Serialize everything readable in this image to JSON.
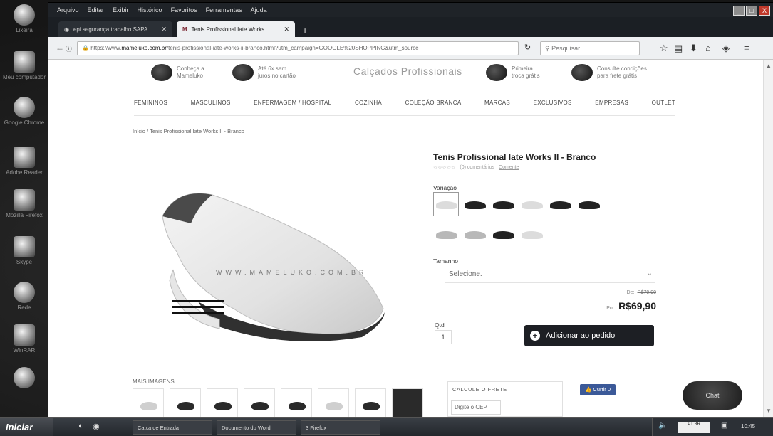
{
  "browser": {
    "menu": [
      "Arquivo",
      "Editar",
      "Exibir",
      "Histórico",
      "Favoritos",
      "Ferramentas",
      "Ajuda"
    ],
    "tabs": [
      {
        "label": "epi segurança trabalho SAPA",
        "active": false
      },
      {
        "label": "Tenis Profissional Iate Works ...",
        "active": true
      }
    ],
    "new_tab": "+",
    "url_prefix": "https://www.",
    "url_domain": "mameluko.com.br",
    "url_rest": "/tenis-profissional-iate-works-ii-branco.html?utm_campaign=GOOGLE%20SHOPPING&utm_source",
    "search_placeholder": "Pesquisar",
    "win_controls": [
      "_",
      "□",
      "X"
    ]
  },
  "header": {
    "benefits": [
      {
        "line1": "Conheça a",
        "line2": "Mameluko"
      },
      {
        "line1": "Até 6x sem",
        "line2": "juros no cartão"
      },
      {
        "line1": "Primeira",
        "line2": "troca grátis"
      },
      {
        "line1": "Consulte condições",
        "line2": "para frete grátis"
      }
    ],
    "logo": "Calçados Profissionais"
  },
  "categories": [
    "FEMININOS",
    "MASCULINOS",
    "ENFERMAGEM / HOSPITAL",
    "COZINHA",
    "COLEÇÃO BRANCA",
    "MARCAS",
    "EXCLUSIVOS",
    "EMPRESAS",
    "OUTLET"
  ],
  "breadcrumb": {
    "home": "Início",
    "separator": " / ",
    "current": "Tenis Profissional Iate Works II - Branco"
  },
  "gallery": {
    "watermark": "WWW.MAMELUKO.COM.BR",
    "more_images": "MAIS IMAGENS"
  },
  "product": {
    "title": "Tenis Profissional Iate Works II - Branco",
    "rating_stars": "☆☆☆☆☆",
    "rating_text": "(0) comentários",
    "rating_link": "Comente",
    "variation_label": "Variação",
    "size_label": "Tamanho",
    "size_value": "Selecione.",
    "old_price_prefix": "De:",
    "old_price": "R$79,90",
    "price_prefix": "Por:",
    "price": "R$69,90",
    "qty_label": "Qtd",
    "qty_value": "1",
    "add_button": "Adicionar ao pedido",
    "shipping_title": "CALCULE O FRETE",
    "cep_placeholder": "Digite o CEP",
    "like_button": "Curtir 0",
    "chat_button": "Chat"
  },
  "desktop_icons": [
    "Lixeira",
    "Meu computador",
    "Google Chrome",
    "Adobe Reader",
    "Mozilla Firefox",
    "Skype",
    "Rede",
    "WinRAR"
  ],
  "taskbar": {
    "start": "Iniciar",
    "tasks": [
      "Caixa de Entrada",
      "Documento do Word",
      "3 Firefox"
    ],
    "lang": "PT BR",
    "clock": "10:45"
  }
}
